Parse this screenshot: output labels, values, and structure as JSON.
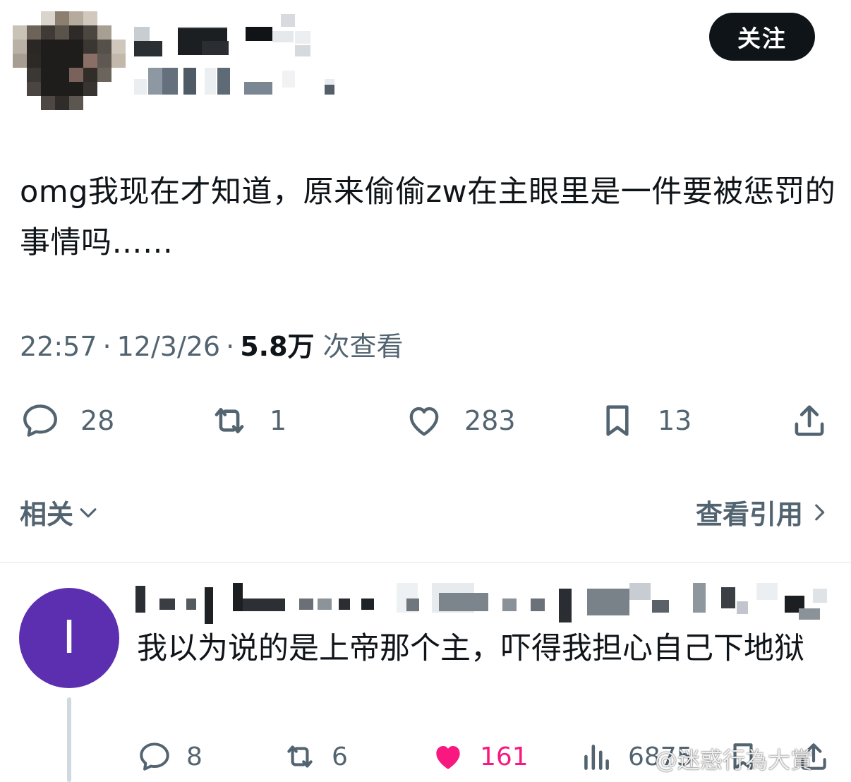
{
  "header": {
    "follow_label": "关注"
  },
  "tweet": {
    "text": "omg我现在才知道，原来偷偷zw在主眼里是一件要被惩罚的事情吗……",
    "time": "22:57",
    "date": "12/3/26",
    "separator": "·",
    "views_count": "5.8万",
    "views_label": "次查看",
    "actions": {
      "replies": "28",
      "retweets": "1",
      "likes": "283",
      "bookmarks": "13"
    }
  },
  "related": {
    "label": "相关",
    "quotes_label": "查看引用"
  },
  "reply": {
    "avatar_letter": "I",
    "avatar_color": "#5b2fb0",
    "text": "我以为说的是上帝那个主，吓得我担心自己下地狱",
    "actions": {
      "replies": "8",
      "retweets": "6",
      "likes": "161",
      "views": "6875"
    }
  },
  "watermark": "@迷惑行為大賞",
  "colors": {
    "text_primary": "#0f1419",
    "text_secondary": "#536471",
    "like_active": "#f91880",
    "follow_bg": "#0f1419"
  }
}
